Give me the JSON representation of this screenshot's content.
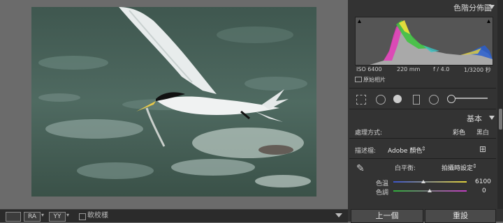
{
  "panel": {
    "histogram_title": "色階分佈圖",
    "exif": {
      "iso": "ISO 6400",
      "focal": "220 mm",
      "aperture": "f / 4.0",
      "shutter": "1/3200 秒"
    },
    "original_photo": "原始相片",
    "basic_title": "基本",
    "treatment_label": "處理方式:",
    "treatment_color": "彩色",
    "treatment_bw": "黑白",
    "profile_label": "描述檔:",
    "profile_value": "Adobe 顏色",
    "wb_label": "白平衡:",
    "wb_value": "拍攝時設定",
    "temp_label": "色溫",
    "temp_value": "6100",
    "tint_label": "色調",
    "tint_value": "0",
    "prev_button": "上一個",
    "reset_button": "重設"
  },
  "toolbar": {
    "view1": "RA",
    "view2": "YY",
    "soft_proof": "軟校樣"
  },
  "colors": {
    "accent": "#d6d6d6",
    "panel": "#333333",
    "background": "#6b6b6b"
  }
}
